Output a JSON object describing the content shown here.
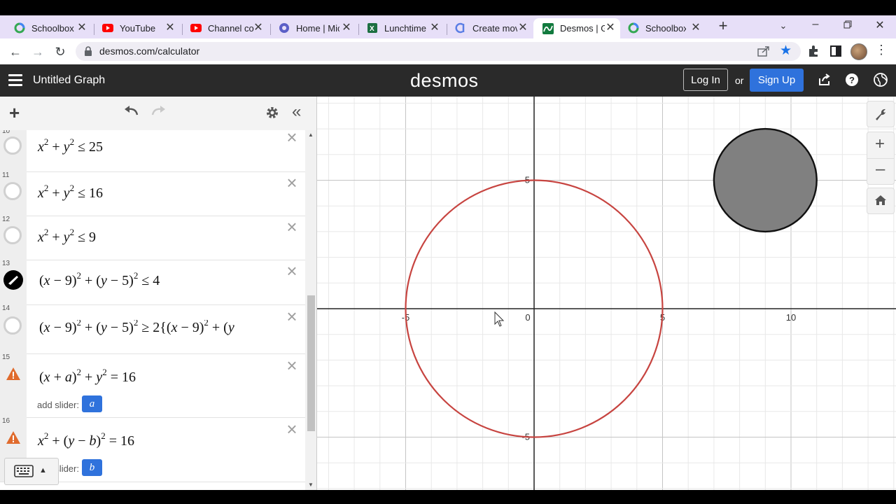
{
  "browser": {
    "tabs": [
      {
        "label": "Schoolbox",
        "icon": "schoolbox-icon"
      },
      {
        "label": "YouTube",
        "icon": "youtube-icon"
      },
      {
        "label": "Channel co",
        "icon": "youtube-icon"
      },
      {
        "label": "Home | Mic",
        "icon": "microsoft-icon"
      },
      {
        "label": "Lunchtime",
        "icon": "excel-icon"
      },
      {
        "label": "Create mov",
        "icon": "clipchamp-icon"
      },
      {
        "label": "Desmos | G",
        "icon": "desmos-icon"
      },
      {
        "label": "Schoolbox",
        "icon": "schoolbox-icon"
      }
    ],
    "active_tab": 6,
    "url": "desmos.com/calculator"
  },
  "header": {
    "title": "Untitled Graph",
    "logo": "desmos",
    "login": "Log In",
    "or": "or",
    "signup": "Sign Up",
    "accent": "#2f72dc"
  },
  "expressions": [
    {
      "num": "10",
      "latex": "x^2 + y^2 ≤ 25",
      "icon": "empty-circle"
    },
    {
      "num": "11",
      "latex": "x^2 + y^2 ≤ 16",
      "icon": "empty-circle"
    },
    {
      "num": "12",
      "latex": "x^2 + y^2 ≤ 9",
      "icon": "empty-circle"
    },
    {
      "num": "13",
      "latex": "(x − 9)^2 + (y − 5)^2 ≤ 4",
      "icon": "filled-black-circle"
    },
    {
      "num": "14",
      "latex": "(x − 9)^2 + (y − 5)^2 ≥ 2{(x − 9)^2 + (y",
      "icon": "empty-circle"
    },
    {
      "num": "15",
      "latex": "(x + a)^2 + y^2 = 16",
      "icon": "warning",
      "slider_label": "add slider:",
      "slider": "a"
    },
    {
      "num": "16",
      "latex": "x^2 + (y − b)^2 = 16",
      "icon": "warning",
      "slider_label": "add slider:",
      "slider": "b"
    }
  ],
  "graph": {
    "x_ticks": [
      "-5",
      "0",
      "5",
      "10"
    ],
    "y_ticks": [
      "5",
      "-5"
    ],
    "red_circle": {
      "cx": 0,
      "cy": 0,
      "r": 5,
      "color": "#c74440"
    },
    "gray_disk": {
      "cx": 9,
      "cy": 5,
      "r": 2,
      "fill": "#808080"
    }
  }
}
